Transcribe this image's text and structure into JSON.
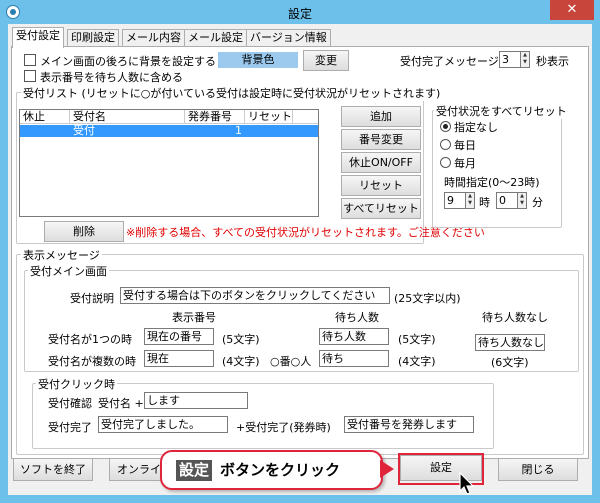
{
  "window": {
    "title": "設定",
    "close_glyph": "✕"
  },
  "tabs": [
    {
      "label": "受付設定"
    },
    {
      "label": "印刷設定"
    },
    {
      "label": "メール内容"
    },
    {
      "label": "メール設定"
    },
    {
      "label": "バージョン情報"
    }
  ],
  "background": {
    "checkbox_label": "メイン画面の後ろに背景を設定する",
    "color_label": "背景色",
    "change_button": "変更",
    "show_number_label": "表示番号を待ち人数に含める"
  },
  "completion_message": {
    "label": "受付完了メッセージ:",
    "value": "3",
    "unit": "秒表示"
  },
  "reception_list": {
    "legend": "受付リスト (リセットに○が付いている受付は設定時に受付状況がリセットされます)",
    "columns": [
      "休止",
      "受付名",
      "発券番号",
      "リセット"
    ],
    "rows": [
      {
        "pause": "",
        "name": "受付",
        "ticket": "1",
        "reset": ""
      }
    ],
    "buttons": {
      "add": "追加",
      "change_number": "番号変更",
      "pause_toggle": "休止ON/OFF",
      "reset": "リセット",
      "reset_all": "すべてリセット"
    },
    "delete_button": "削除",
    "warning": "※削除する場合、すべての受付状況がリセットされます。ご注意ください"
  },
  "reset_all_group": {
    "legend": "受付状況をすべてリセット",
    "options": [
      "指定なし",
      "毎日",
      "毎月"
    ],
    "selected": 0,
    "time_label": "時間指定(0〜23時)",
    "hour_value": "9",
    "hour_unit": "時",
    "minute_value": "0",
    "minute_unit": "分"
  },
  "display_message": {
    "legend": "表示メッセージ",
    "main_screen": {
      "legend": "受付メイン画面",
      "desc_label": "受付説明",
      "desc_value": "受付する場合は下のボタンをクリックしてください",
      "desc_hint": "(25文字以内)",
      "col_display_number": "表示番号",
      "col_waiting": "待ち人数",
      "col_no_waiting": "待ち人数なし",
      "row1_label": "受付名が1つの時",
      "row1_number_value": "現在の番号",
      "row1_number_hint": "(5文字)",
      "row1_waiting_value": "待ち人数",
      "row1_waiting_hint": "(5文字)",
      "no_waiting_value": "待ち人数なし",
      "no_waiting_hint": "(6文字)",
      "row2_label": "受付名が複数の時",
      "row2_number_value": "現在",
      "row2_number_hint": "(4文字)",
      "row2_mid": "○番○人",
      "row2_waiting_value": "待ち",
      "row2_waiting_hint": "(4文字)"
    },
    "click_time": {
      "legend": "受付クリック時",
      "confirm_label": "受付確認",
      "confirm_prefix": "受付名 +",
      "confirm_value": "します",
      "complete_label": "受付完了",
      "complete_value": "受付完了しました。",
      "complete_issue_label": "+受付完了(発券時)",
      "complete_issue_value": "受付番号を発券します"
    }
  },
  "footer": {
    "quit_button": "ソフトを終了",
    "online_button": "オンライ",
    "settings_button": "設定",
    "close_button": "閉じる"
  },
  "callout": {
    "tag": "設定",
    "text": "ボタンをクリック"
  },
  "colors": {
    "titlebar": "#6cc0ea",
    "selection": "#3399ff",
    "accent_red": "#e0243a",
    "swatch": "#9ccaee"
  }
}
